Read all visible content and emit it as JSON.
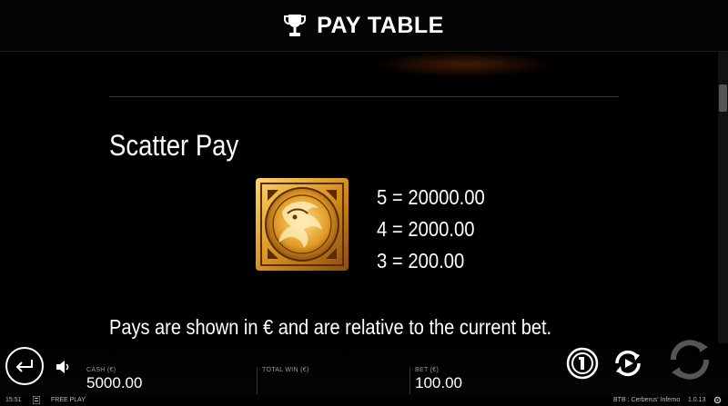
{
  "header": {
    "title": "PAY TABLE",
    "icon": "trophy-icon"
  },
  "scatter": {
    "heading": "Scatter Pay",
    "symbol": "cerberus-scatter-symbol",
    "payouts": [
      "5 = 20000.00",
      "4 = 2000.00",
      "3 = 200.00"
    ]
  },
  "note": "Pays are shown in € and are relative to the current bet.",
  "footer": {
    "cash_label": "CASH (€)",
    "cash_value": "5000.00",
    "total_win_label": "TOTAL WIN (€)",
    "total_win_value": "",
    "bet_label": "BET (€)",
    "bet_value": "100.00"
  },
  "status_bar": {
    "time": "15:51",
    "mode": "FREE PLAY",
    "game_name": "BTB : Cerberus' Inferno",
    "version": "1.0.13"
  },
  "colors": {
    "background": "#000000",
    "gold": "#e3a52c",
    "text": "#ffffff"
  }
}
